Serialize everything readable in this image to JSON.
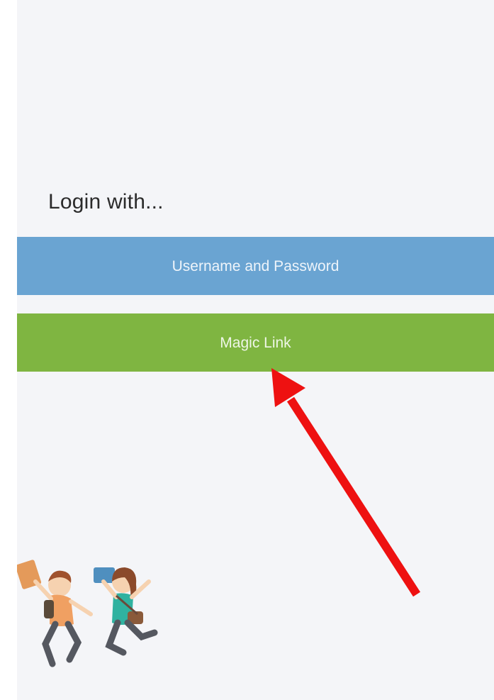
{
  "login": {
    "heading": "Login with...",
    "username_password_label": "Username and Password",
    "magic_link_label": "Magic Link"
  },
  "colors": {
    "background": "#f4f5f8",
    "username_button": "#6aa4d2",
    "magic_link_button": "#7fb541",
    "annotation_arrow": "#ee1111"
  },
  "illustration": {
    "icon": "jumping-students-illustration"
  },
  "annotation": {
    "icon": "red-arrow-pointer",
    "target": "magic-link-button"
  }
}
